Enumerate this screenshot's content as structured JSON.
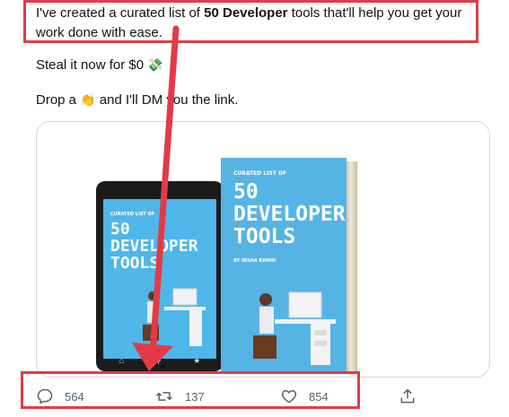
{
  "tweet": {
    "line1_before": "I've created a curated list of ",
    "line1_bold": "50 Developer",
    "line1_after": " tools that'll help you get your work done with ease.",
    "line2": "Steal it now for $0",
    "line2_emoji": "💸",
    "line3_before": "Drop a",
    "line3_emoji": "👏",
    "line3_after": "and I'll DM you the link."
  },
  "media": {
    "tablet_small": "CURATED LIST OF",
    "tablet_title_1": "50",
    "tablet_title_2": "DEVELOPER",
    "tablet_title_3": "TOOLS",
    "book_small": "CURATED LIST OF",
    "book_title_1": "50",
    "book_title_2": "DEVELOPER",
    "book_title_3": "TOOLS",
    "author": "BY INSHA RAMIN"
  },
  "actions": {
    "replies": "564",
    "retweets": "137",
    "likes": "854"
  },
  "colors": {
    "annotation_red": "#e23b47",
    "action_gray": "#536471",
    "cover_blue": "#56b4e4"
  }
}
